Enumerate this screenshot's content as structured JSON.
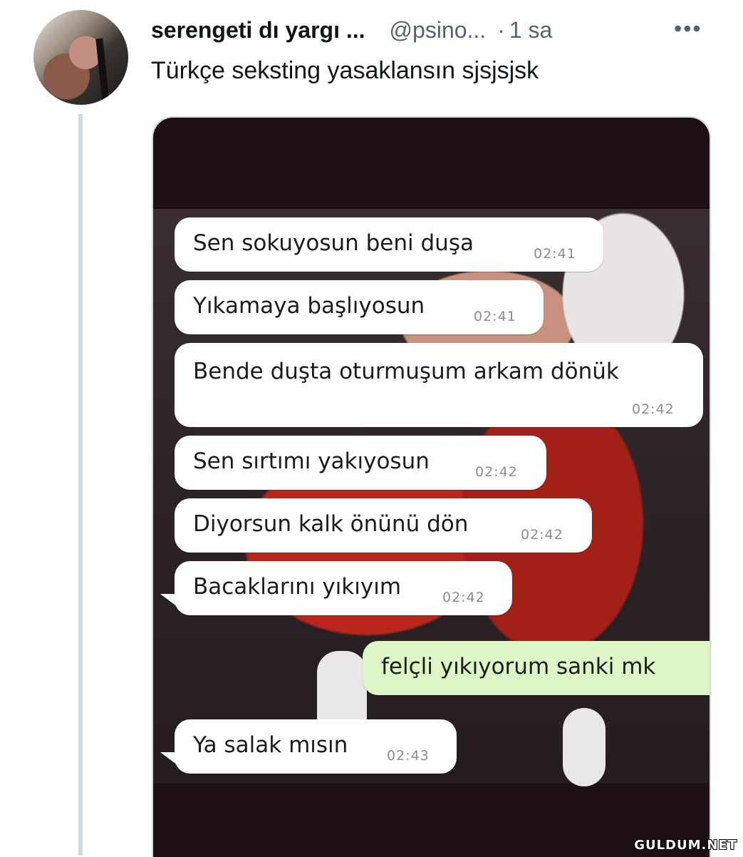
{
  "tweet": {
    "author_name": "serengeti dı yargı ...",
    "handle": "@psino...",
    "separator": "·",
    "time": "1 sa",
    "more_label": "•••",
    "text": "Türkçe seksting yasaklansın sjsjsjsk"
  },
  "chat": {
    "messages": [
      {
        "text": "Sen sokuyosun beni duşa",
        "time": "02:41",
        "direction": "received"
      },
      {
        "text": "Yıkamaya başlıyosun",
        "time": "02:41",
        "direction": "received"
      },
      {
        "text": "Bende duşta oturmuşum arkam dönük",
        "time": "02:42",
        "direction": "received"
      },
      {
        "text": "Sen sırtımı yakıyosun",
        "time": "02:42",
        "direction": "received"
      },
      {
        "text": "Diyorsun kalk önünü dön",
        "time": "02:42",
        "direction": "received"
      },
      {
        "text": "Bacaklarını yıkıyım",
        "time": "02:42",
        "direction": "received"
      },
      {
        "text": "felçli yıkıyorum sanki mk",
        "time": "",
        "direction": "sent"
      },
      {
        "text": "Ya salak mısın",
        "time": "02:43",
        "direction": "received"
      }
    ]
  },
  "watermark": "GULDUM.NET"
}
